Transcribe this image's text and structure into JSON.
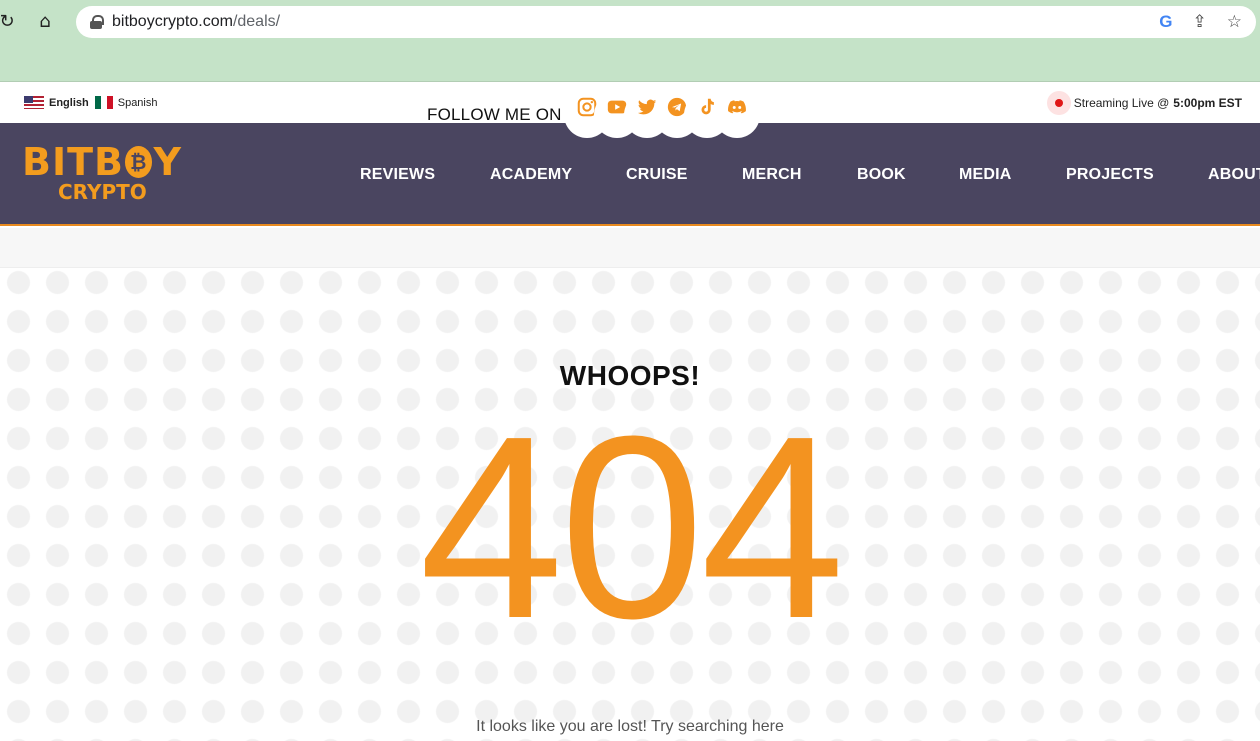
{
  "browser": {
    "url_domain": "bitboycrypto.com",
    "url_path": "/deals/",
    "reload_icon": "reload-icon",
    "home_icon": "home-icon",
    "right_icons": [
      "google-lens-icon",
      "share-icon",
      "bookmark-star-icon"
    ],
    "google_letter": "G",
    "share_glyph": "⇪",
    "star_glyph": "☆",
    "reload_glyph": "↻",
    "home_glyph": "⌂"
  },
  "topbar": {
    "languages": [
      {
        "label": "English",
        "flag": "us-flag"
      },
      {
        "label": "Spanish",
        "flag": "mexico-flag"
      }
    ],
    "follow_label": "FOLLOW ME ON",
    "socials": [
      "instagram-icon",
      "youtube-icon",
      "twitter-icon",
      "telegram-icon",
      "tiktok-icon",
      "discord-icon"
    ],
    "social_color": "#f39320",
    "live_label": "Streaming Live @",
    "live_time": "5:00pm EST"
  },
  "nav": {
    "logo_top": "BITB",
    "logo_top_end": "Y",
    "logo_coin": "₿",
    "logo_bottom": "CRYPTO",
    "items": [
      "REVIEWS",
      "ACADEMY",
      "CRUISE",
      "MERCH",
      "BOOK",
      "MEDIA",
      "PROJECTS",
      "ABOUT"
    ],
    "background": "#4a4560",
    "accent": "#f39c1e"
  },
  "main": {
    "heading": "WHOOPS!",
    "code": "404",
    "message": "It looks like you are lost! Try searching here"
  }
}
